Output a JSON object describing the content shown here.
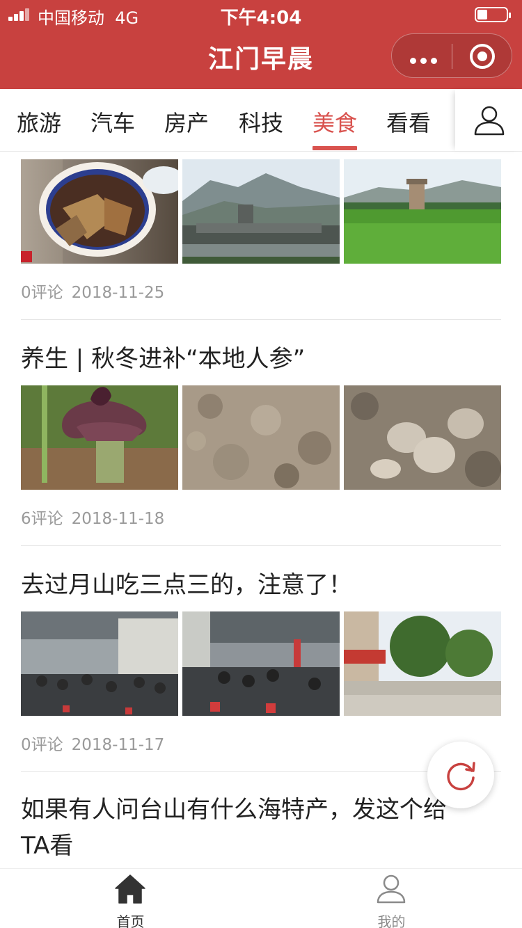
{
  "status_bar": {
    "carrier": "中国移动",
    "network": "4G",
    "time": "下午4:04"
  },
  "nav": {
    "title": "江门早晨",
    "more_icon": "more-dots-icon",
    "close_icon": "target-circle-icon"
  },
  "tabs": [
    {
      "label": "旅游",
      "active": false
    },
    {
      "label": "汽车",
      "active": false
    },
    {
      "label": "房产",
      "active": false
    },
    {
      "label": "科技",
      "active": false
    },
    {
      "label": "美食",
      "active": true
    },
    {
      "label": "看看",
      "active": false
    }
  ],
  "user_icon": "user-outline-icon",
  "feed": [
    {
      "title": "",
      "images": [
        "herbal-soup-photo",
        "village-mountain-photo",
        "rice-field-tower-photo"
      ],
      "comments": "0评论",
      "date": "2018-11-25"
    },
    {
      "title": "养生 | 秋冬进补“本地人参”",
      "images": [
        "konjac-flower-photo",
        "soil-photo",
        "tuber-root-photo"
      ],
      "comments": "6评论",
      "date": "2018-11-18"
    },
    {
      "title": "去过月山吃三点三的，注意了！",
      "images": [
        "market-shed-crowd-photo",
        "outdoor-dining-crowd-photo",
        "street-trees-photo"
      ],
      "comments": "0评论",
      "date": "2018-11-17"
    },
    {
      "title": "如果有人问台山有什么海特产，发这个给TA看"
    }
  ],
  "refresh_icon": "refresh-icon",
  "tabbar": {
    "home": {
      "label": "首页",
      "icon": "home-icon"
    },
    "me": {
      "label": "我的",
      "icon": "person-icon"
    }
  },
  "colors": {
    "brand": "#c8413f",
    "accent": "#d9534f",
    "meta": "#9a9a9a"
  }
}
